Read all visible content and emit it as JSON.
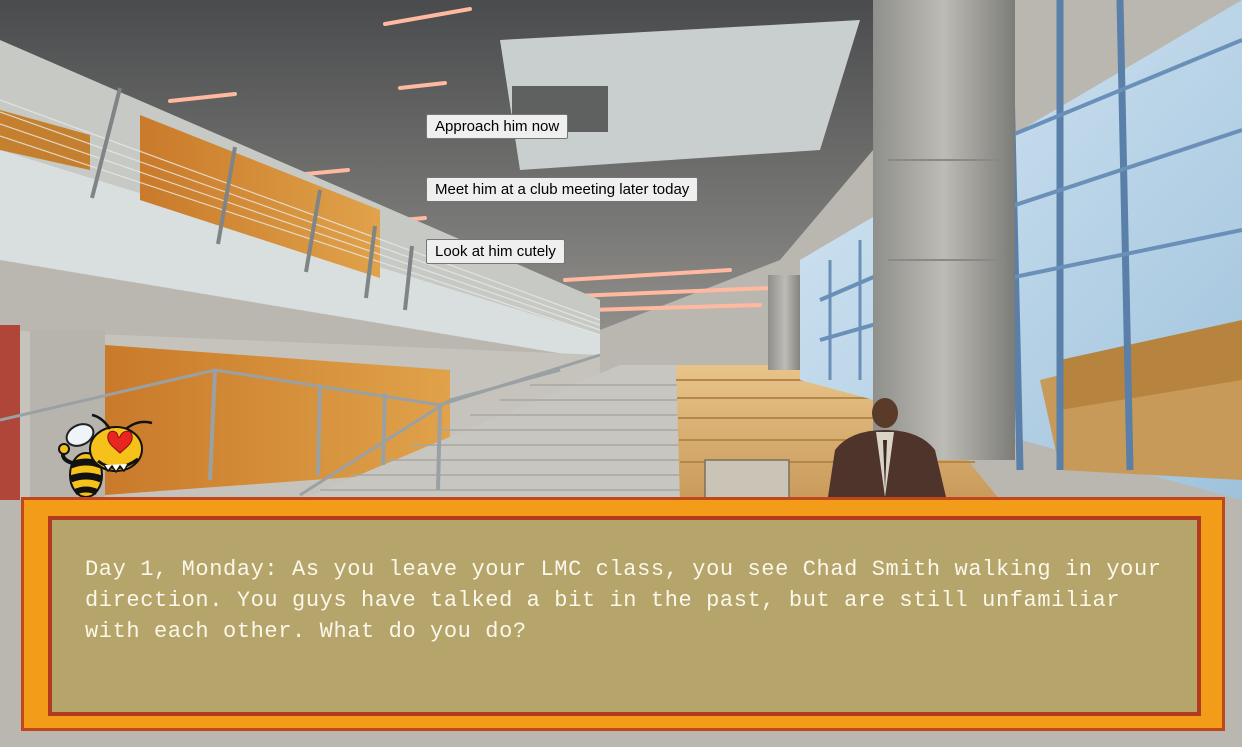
{
  "scene": {
    "name": "atrium-with-staircase",
    "character": "chad-smith-figure"
  },
  "choices": [
    {
      "label": "Approach him now"
    },
    {
      "label": "Meet him at a club meeting later today"
    },
    {
      "label": "Look at him cutely"
    }
  ],
  "dialog": {
    "text": "Day 1, Monday: As you leave your LMC class, you see Chad Smith walking in your direction. You guys have talked a bit in the past, but are still unfamiliar with each other. What do you do?"
  },
  "mascot": {
    "icon": "yellow-jacket-heart-eyes-icon"
  },
  "colors": {
    "dialog_outer": "#f39c1a",
    "dialog_outer_border": "#c0471b",
    "dialog_inner": "#b5a56b",
    "dialog_inner_border": "#b33a1c",
    "dialog_text": "#fbf7ea"
  }
}
